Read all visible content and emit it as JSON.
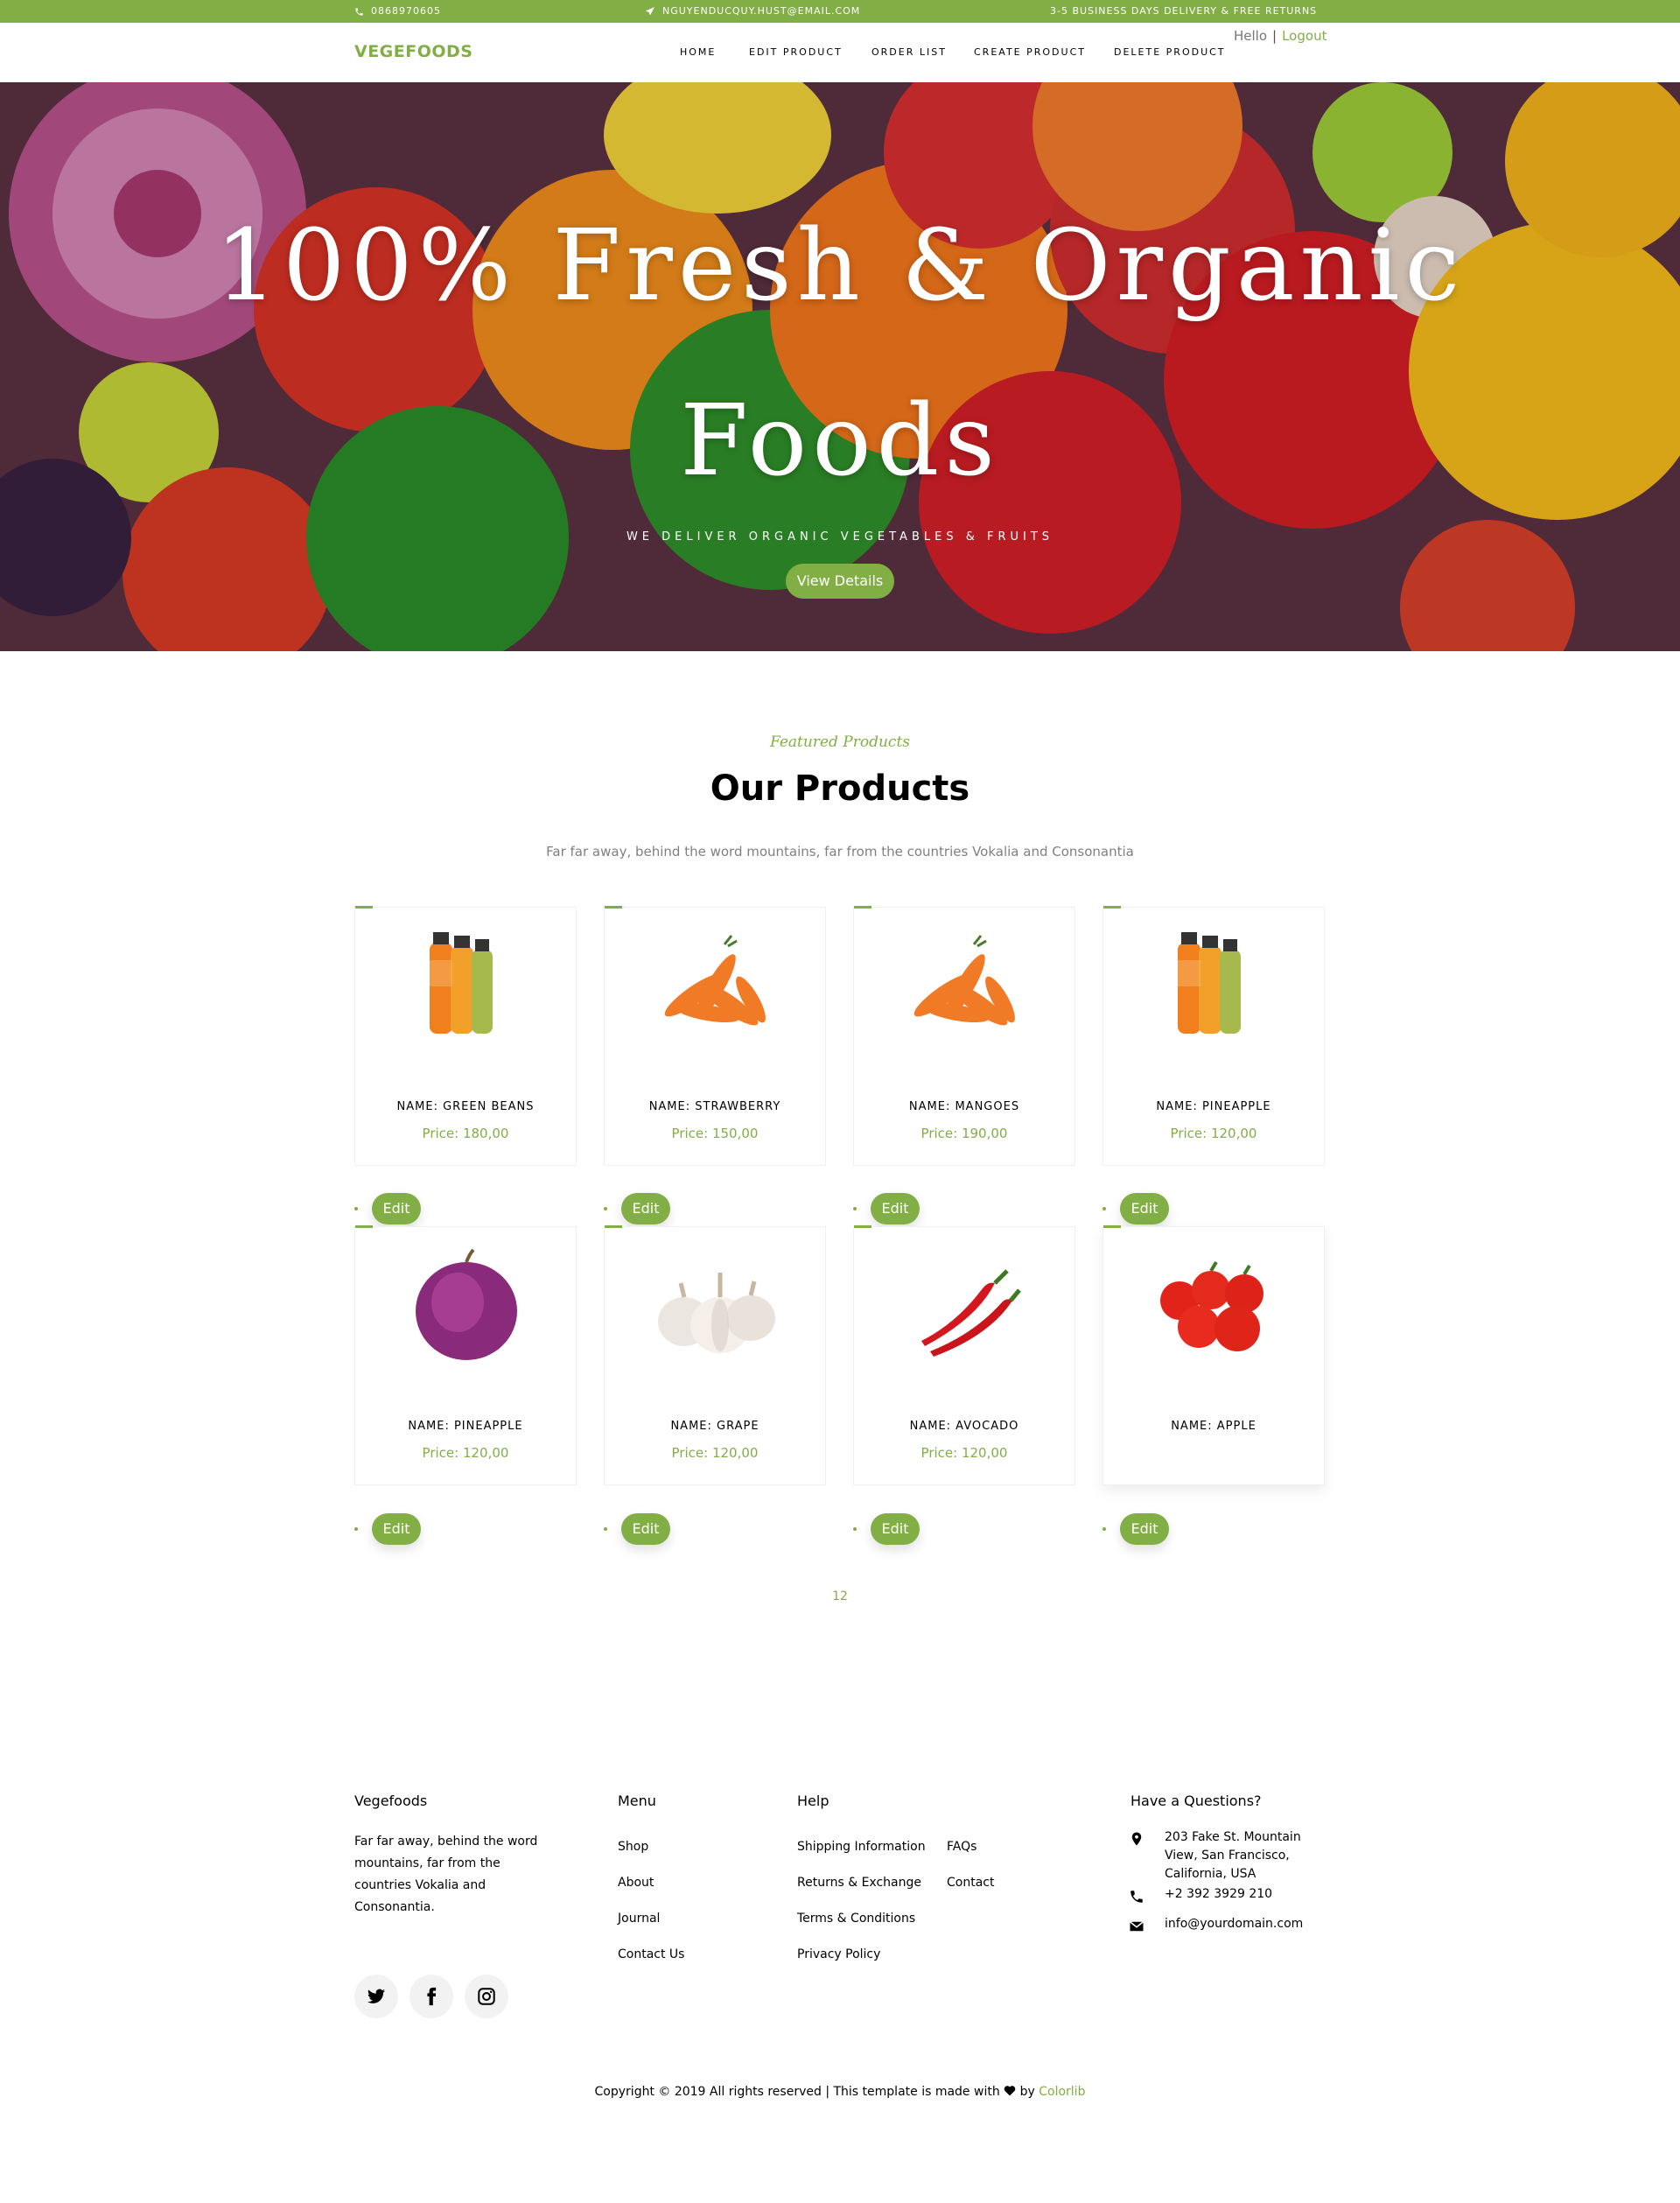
{
  "topbar": {
    "phone": "0868970605",
    "email": "NGUYENDUCQUY.HUST@EMAIL.COM",
    "shipping": "3-5 BUSINESS DAYS DELIVERY & FREE RETURNS"
  },
  "navbar": {
    "brand": "VEGEFOODS",
    "items": [
      "HOME",
      "EDIT PRODUCT",
      "ORDER LIST",
      "CREATE PRODUCT",
      "DELETE PRODUCT"
    ],
    "user": {
      "greeting": "Hello",
      "separator": "|",
      "logout": "Logout"
    }
  },
  "hero": {
    "title_line1": "100% Fresh & Organic",
    "title_line2": "Foods",
    "subtitle": "WE DELIVER ORGANIC VEGETABLES & FRUITS",
    "button": "View Details"
  },
  "section": {
    "kicker": "Featured Products",
    "title": "Our Products",
    "description": "Far far away, behind the word mountains, far from the countries Vokalia and Consonantia"
  },
  "products": [
    {
      "name": "NAME: GREEN BEANS",
      "price": "Price: 180,00",
      "image": "juice-bottles",
      "edit": "Edit"
    },
    {
      "name": "NAME: STRAWBERRY",
      "price": "Price: 150,00",
      "image": "carrots",
      "edit": "Edit"
    },
    {
      "name": "NAME: MANGOES",
      "price": "Price: 190,00",
      "image": "carrots",
      "edit": "Edit"
    },
    {
      "name": "NAME: PINEAPPLE",
      "price": "Price: 120,00",
      "image": "juice-bottles",
      "edit": "Edit"
    },
    {
      "name": "NAME: PINEAPPLE",
      "price": "Price: 120,00",
      "image": "red-onion",
      "edit": "Edit"
    },
    {
      "name": "NAME: GRAPE",
      "price": "Price: 120,00",
      "image": "garlic",
      "edit": "Edit"
    },
    {
      "name": "NAME: AVOCADO",
      "price": "Price: 120,00",
      "image": "chili-peppers",
      "edit": "Edit"
    },
    {
      "name": "NAME: APPLE",
      "price": "",
      "image": "tomatoes",
      "edit": "Edit"
    }
  ],
  "pagination": "12",
  "footer": {
    "about": {
      "title": "Vegefoods",
      "text": "Far far away, behind the word mountains, far from the countries Vokalia and Consonantia."
    },
    "menu": {
      "title": "Menu",
      "links": [
        "Shop",
        "About",
        "Journal",
        "Contact Us"
      ]
    },
    "help": {
      "title": "Help",
      "links_col1": [
        "Shipping Information",
        "Returns & Exchange",
        "Terms & Conditions",
        "Privacy Policy"
      ],
      "links_col2": [
        "FAQs",
        "Contact"
      ]
    },
    "contact": {
      "title": "Have a Questions?",
      "address": "203 Fake St. Mountain View, San Francisco, California, USA",
      "phone": "+2 392 3929 210",
      "email": "info@yourdomain.com"
    },
    "social": [
      "twitter-icon",
      "facebook-icon",
      "instagram-icon"
    ],
    "copyright_prefix": "Copyright © 2019 All rights reserved | This template is made with",
    "copyright_by": "by",
    "copyright_brand": "Colorlib"
  },
  "colors": {
    "accent": "#82ae46",
    "text": "#000000",
    "muted": "#808080"
  }
}
